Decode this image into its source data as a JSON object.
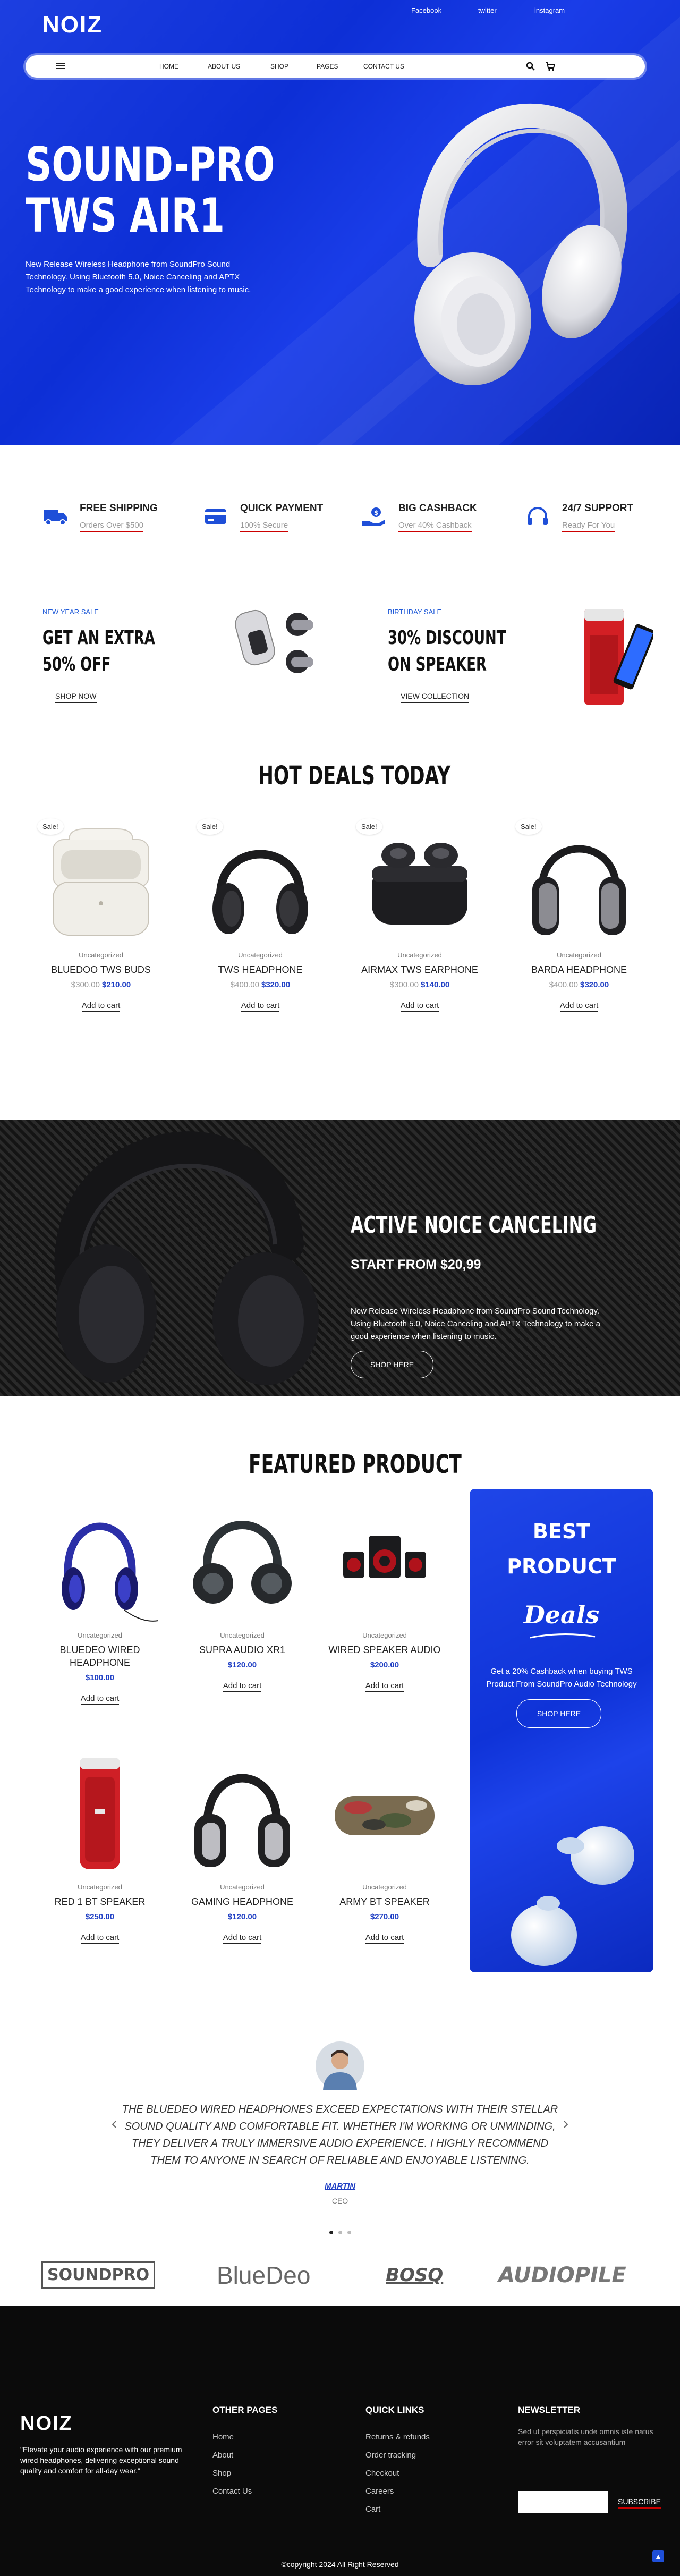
{
  "header": {
    "logo": "NOIZ",
    "social": [
      "Facebook",
      "twitter",
      "instagram"
    ],
    "nav": [
      "HOME",
      "ABOUT US",
      "SHOP",
      "PAGES",
      "CONTACT US"
    ]
  },
  "hero": {
    "title_line1": "SOUND-PRO",
    "title_line2": "TWS AIR1",
    "description": "New Release Wireless Headphone from SoundPro Sound Technology. Using Bluetooth 5.0, Noice Canceling and APTX Technology to make a good experience when listening to music."
  },
  "features": [
    {
      "title": "FREE SHIPPING",
      "subtitle": "Orders Over $500",
      "icon": "truck-icon"
    },
    {
      "title": "QUICK PAYMENT",
      "subtitle": "100% Secure",
      "icon": "credit-card-icon"
    },
    {
      "title": "BIG CASHBACK",
      "subtitle": "Over 40% Cashback",
      "icon": "cashback-icon"
    },
    {
      "title": "24/7 SUPPORT",
      "subtitle": "Ready For You",
      "icon": "headset-icon"
    }
  ],
  "promos": [
    {
      "tag": "NEW YEAR SALE",
      "line1": "GET AN EXTRA",
      "line2": "50% OFF",
      "link": "SHOP NOW"
    },
    {
      "tag": "BIRTHDAY SALE",
      "line1": "30% DISCOUNT",
      "line2": "ON SPEAKER",
      "link": "VIEW COLLECTION"
    }
  ],
  "hot_deals": {
    "title": "HOT DEALS TODAY",
    "items": [
      {
        "badge": "Sale!",
        "category": "Uncategorized",
        "name": "BLUEDOO TWS BUDS",
        "old_price": "$300.00",
        "price": "$210.00",
        "action": "Add to cart"
      },
      {
        "badge": "Sale!",
        "category": "Uncategorized",
        "name": "TWS HEADPHONE",
        "old_price": "$400.00",
        "price": "$320.00",
        "action": "Add to cart"
      },
      {
        "badge": "Sale!",
        "category": "Uncategorized",
        "name": "AIRMAX TWS EARPHONE",
        "old_price": "$300.00",
        "price": "$140.00",
        "action": "Add to cart"
      },
      {
        "badge": "Sale!",
        "category": "Uncategorized",
        "name": "BARDA HEADPHONE",
        "old_price": "$400.00",
        "price": "$320.00",
        "action": "Add to cart"
      }
    ]
  },
  "banner": {
    "title": "ACTIVE NOICE CANCELING",
    "subtitle": "START FROM $20,99",
    "description": "New Release Wireless Headphone from SoundPro Sound Technology. Using Bluetooth 5.0, Noice Canceling and APTX Technology to make a good experience when listening to music.",
    "button": "SHOP HERE"
  },
  "featured": {
    "title": "FEATURED PRODUCT",
    "items": [
      {
        "category": "Uncategorized",
        "name": "BLUEDEO WIRED HEADPHONE",
        "price": "$100.00",
        "action": "Add to cart"
      },
      {
        "category": "Uncategorized",
        "name": "SUPRA AUDIO XR1",
        "price": "$120.00",
        "action": "Add to cart"
      },
      {
        "category": "Uncategorized",
        "name": "WIRED SPEAKER AUDIO",
        "price": "$200.00",
        "action": "Add to cart"
      },
      {
        "category": "Uncategorized",
        "name": "RED 1 BT SPEAKER",
        "price": "$250.00",
        "action": "Add to cart"
      },
      {
        "category": "Uncategorized",
        "name": "GAMING HEADPHONE",
        "price": "$120.00",
        "action": "Add to cart"
      },
      {
        "category": "Uncategorized",
        "name": "ARMY BT SPEAKER",
        "price": "$270.00",
        "action": "Add to cart"
      }
    ]
  },
  "deals": {
    "line1": "BEST",
    "line2": "PRODUCT",
    "script": "Deals",
    "description": "Get a 20% Cashback when buying TWS Product From SoundPro Audio Technology",
    "button": "SHOP HERE"
  },
  "testimonial": {
    "quote": "THE BLUEDEO WIRED HEADPHONES EXCEED EXPECTATIONS WITH THEIR STELLAR SOUND QUALITY AND COMFORTABLE FIT. WHETHER I'M WORKING OR UNWINDING, THEY DELIVER A TRULY IMMERSIVE AUDIO EXPERIENCE. I HIGHLY RECOMMEND THEM TO ANYONE IN SEARCH OF RELIABLE AND ENJOYABLE LISTENING.",
    "name": "MARTIN",
    "role": "CEO"
  },
  "brands": [
    "SOUNDPRO",
    "BlueDeo",
    "BOSQ",
    "AUDIOPILE"
  ],
  "footer": {
    "logo": "NOIZ",
    "about": "\"Elevate your audio experience with our premium wired headphones, delivering exceptional sound quality and comfort for all-day wear.\"",
    "other_pages_title": "OTHER PAGES",
    "other_pages": [
      "Home",
      "About",
      "Shop",
      "Contact Us"
    ],
    "quick_links_title": "QUICK LINKS",
    "quick_links": [
      "Returns & refunds",
      "Order tracking",
      "Checkout",
      "Careers",
      "Cart"
    ],
    "newsletter_title": "NEWSLETTER",
    "newsletter_text": "Sed ut perspiciatis unde omnis iste natus error sit voluptatem accusantium",
    "subscribe": "SUBSCRIBE",
    "copyright": "©copyright 2024 All Right Reserved"
  },
  "colors": {
    "brand_blue": "#1538e0",
    "price_blue": "#1f3fc4",
    "footer_bg": "#0b0b0b"
  }
}
